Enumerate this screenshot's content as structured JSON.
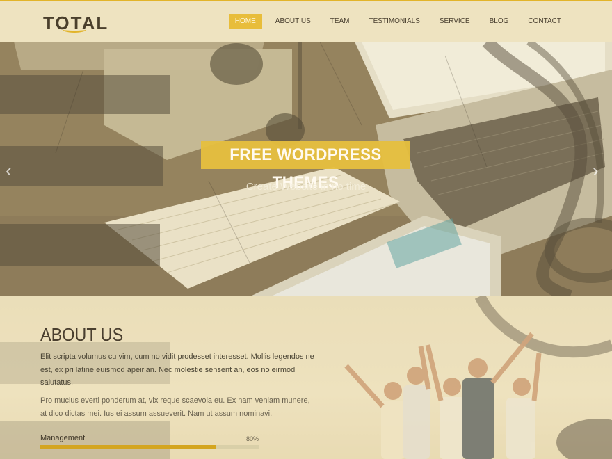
{
  "header": {
    "logo": "TOTAL",
    "nav": [
      {
        "label": "HOME",
        "active": true
      },
      {
        "label": "ABOUT US",
        "active": false
      },
      {
        "label": "TEAM",
        "active": false
      },
      {
        "label": "TESTIMONIALS",
        "active": false
      },
      {
        "label": "SERVICE",
        "active": false
      },
      {
        "label": "BLOG",
        "active": false
      },
      {
        "label": "CONTACT",
        "active": false
      }
    ]
  },
  "hero": {
    "title": "FREE WORDPRESS THEMES",
    "subtitle": "Create Website in no time",
    "prev_icon": "chevron-left-icon",
    "next_icon": "chevron-right-icon"
  },
  "about": {
    "title": "ABOUT US",
    "paragraph1": "Elit scripta volumus cu vim, cum no vidit prodesset interesset. Mollis legendos ne est, ex pri latine euismod apeirian. Nec molestie sensent an, eos no eirmod salutatus.",
    "paragraph2": "Pro mucius everti ponderum at, vix reque scaevola eu. Ex nam veniam munere, at dico dictas mei. Ius ei assum assueverit. Nam ut assum nominavi.",
    "skill": {
      "label": "Management",
      "value_text": "80%",
      "value": 0.8
    }
  },
  "colors": {
    "accent": "#e8bd3a",
    "text_dark": "#4a3f2f"
  }
}
